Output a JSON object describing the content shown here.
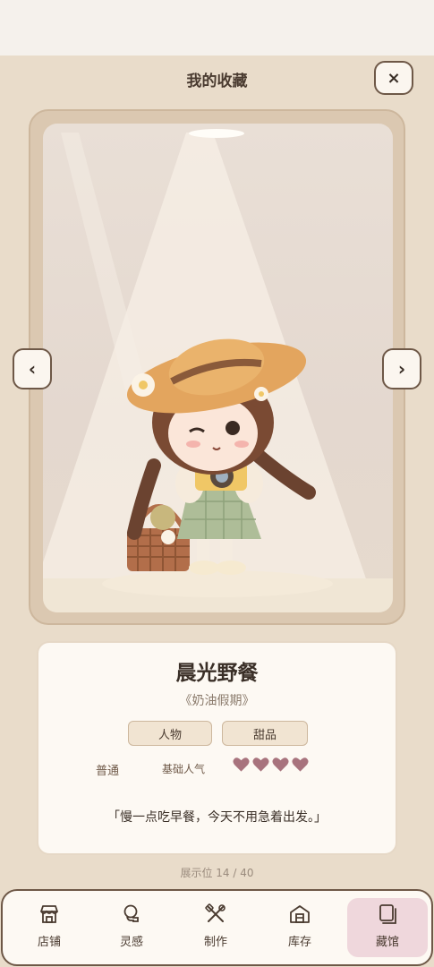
{
  "header": {
    "title": "我的收藏",
    "close_icon": "×"
  },
  "display": {
    "prev_label": "‹",
    "next_label": "›"
  },
  "item": {
    "name": "晨光野餐",
    "series": "《奶油假期》",
    "tags": [
      "人物",
      "甜品"
    ],
    "rarity": "普通",
    "popularity_label": "基础人气",
    "popularity_hearts": 4,
    "quote": "「慢一点吃早餐，今天不用急着出发。」"
  },
  "slot_indicator": "展示位 14 / 40",
  "nav": {
    "items": [
      {
        "label": "店铺",
        "icon": "shop-icon"
      },
      {
        "label": "灵感",
        "icon": "idea-icon"
      },
      {
        "label": "制作",
        "icon": "tools-icon"
      },
      {
        "label": "库存",
        "icon": "storage-icon"
      },
      {
        "label": "藏馆",
        "icon": "collection-icon",
        "active": true
      }
    ]
  },
  "colors": {
    "accent": "#efd7dc",
    "heart": "#a8737d",
    "border": "#6e5847"
  }
}
